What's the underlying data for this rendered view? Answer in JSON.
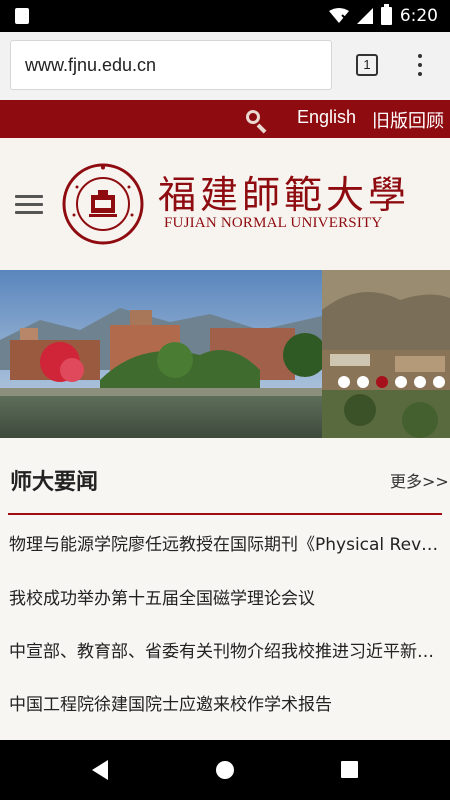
{
  "status_bar": {
    "time": "6:20"
  },
  "browser": {
    "url": "www.fjnu.edu.cn",
    "tab_count": "1"
  },
  "top_bar": {
    "lang": "English",
    "old_site": "旧版回顾"
  },
  "header": {
    "title_cn": "福建師範大學",
    "title_en": "FUJIAN NORMAL UNIVERSITY",
    "seal_text": "FUJIAN NORMAL UNIVERSITY 1907"
  },
  "banner": {
    "slides": 6,
    "active": 3
  },
  "news": {
    "title": "师大要闻",
    "more": "更多>>",
    "items": [
      "物理与能源学院廖任远教授在国际期刊《Physical Review Letters》发表论文",
      "我校成功举办第十五届全国磁学理论会议",
      "中宣部、教育部、省委有关刊物介绍我校推进习近平新时代中国特色社会主义思想",
      "中国工程院徐建国院士应邀来校作学术报告"
    ]
  },
  "colors": {
    "brand": "#8e0b10",
    "active_dot": "#a5101a"
  }
}
